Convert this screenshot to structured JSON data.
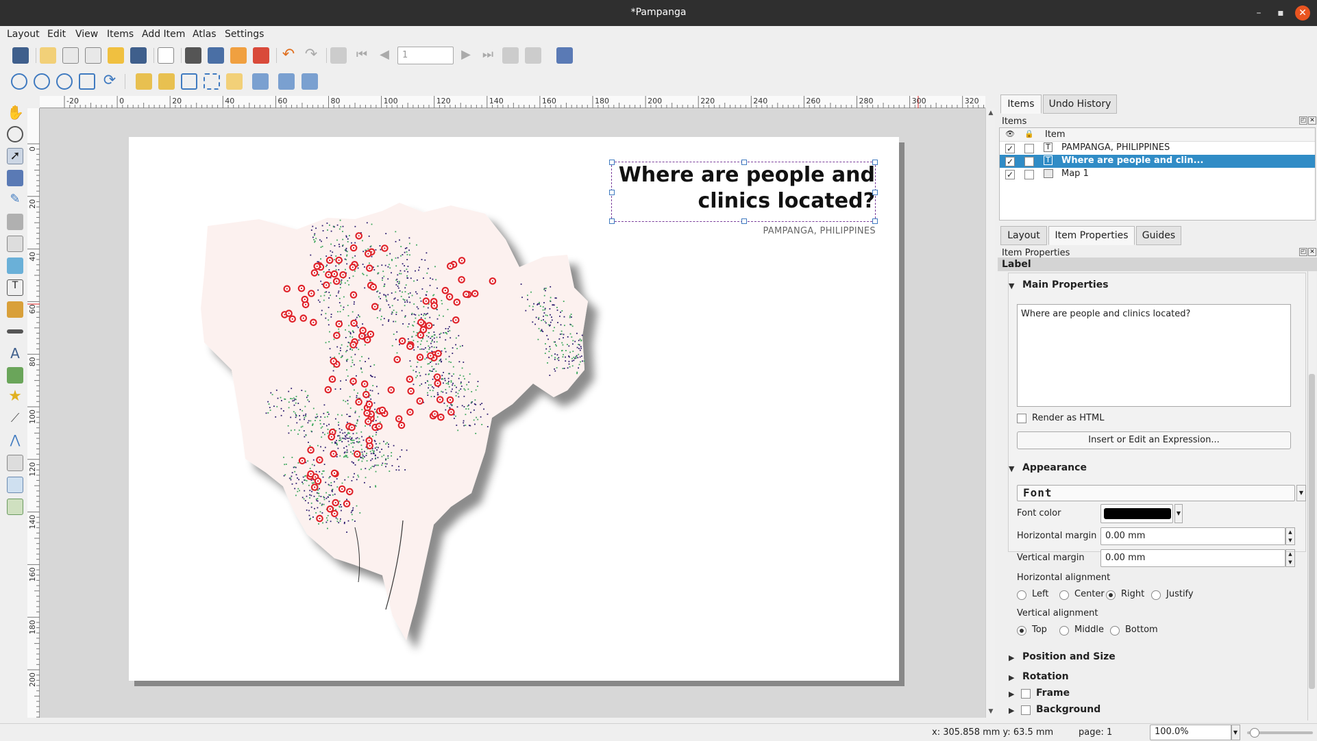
{
  "window": {
    "title": "*Pampanga"
  },
  "menu": [
    "Layout",
    "Edit",
    "View",
    "Items",
    "Add Item",
    "Atlas",
    "Settings"
  ],
  "atlas": {
    "page_value": "1"
  },
  "ruler": {
    "h_ticks": [
      "-20",
      "0",
      "20",
      "40",
      "60",
      "80",
      "100",
      "120",
      "140",
      "160",
      "180",
      "200",
      "220",
      "240",
      "260",
      "280",
      "300",
      "320"
    ],
    "v_ticks": [
      "0",
      "20",
      "40",
      "60",
      "80",
      "100",
      "120",
      "140",
      "160",
      "180",
      "200"
    ]
  },
  "map_label": {
    "title_line1": "Where are people and",
    "title_line2": "clinics located?",
    "subtitle": "PAMPANGA, PHILIPPINES"
  },
  "items_panel": {
    "tabs": [
      "Items",
      "Undo History"
    ],
    "header": "Items",
    "column": "Item",
    "rows": [
      {
        "name": "PAMPANGA, PHILIPPINES",
        "visible": true,
        "selected": false
      },
      {
        "name": "Where are people and clin...",
        "visible": true,
        "selected": true
      },
      {
        "name": "Map 1",
        "visible": true,
        "selected": false
      }
    ]
  },
  "props_panel": {
    "tabs": [
      "Layout",
      "Item Properties",
      "Guides"
    ],
    "header": "Item Properties",
    "item_type": "Label",
    "main_properties": "Main Properties",
    "label_text": "Where are people and clinics located?",
    "render_html": "Render as HTML",
    "insert_expr": "Insert or Edit an Expression...",
    "appearance": "Appearance",
    "font_button": "Font",
    "font_color_label": "Font color",
    "font_color": "#000000",
    "h_margin_label": "Horizontal margin",
    "h_margin": "0.00 mm",
    "v_margin_label": "Vertical margin",
    "v_margin": "0.00 mm",
    "h_align_label": "Horizontal alignment",
    "h_align_options": [
      "Left",
      "Center",
      "Right",
      "Justify"
    ],
    "h_align_selected": "Right",
    "v_align_label": "Vertical alignment",
    "v_align_options": [
      "Top",
      "Middle",
      "Bottom"
    ],
    "v_align_selected": "Top",
    "collapsed_sections": [
      "Position and Size",
      "Rotation",
      "Frame",
      "Background"
    ]
  },
  "status": {
    "coords": "x: 305.858 mm  y: 63.5 mm",
    "page": "page: 1",
    "zoom": "100.0%"
  },
  "colors": {
    "selection": "#308cc6",
    "clinic_marker": "#e0242b",
    "pop_dark": "#2b1a6e",
    "pop_green": "#3aa65a",
    "map_fill": "#fcf1ef"
  }
}
